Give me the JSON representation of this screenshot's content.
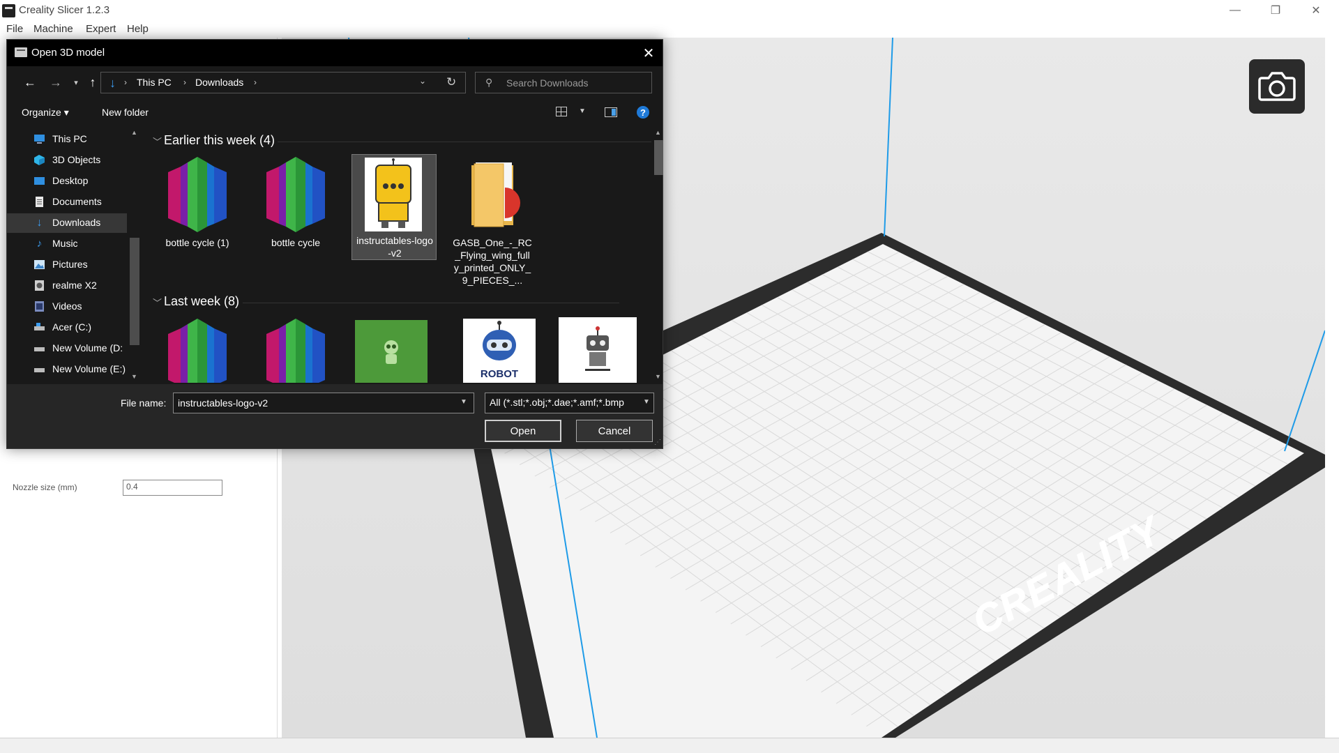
{
  "app": {
    "title": "Creality Slicer 1.2.3",
    "menu": [
      "File",
      "Machine",
      "Expert",
      "Help"
    ],
    "window_controls": {
      "minimize": "—",
      "restore": "❐",
      "close": "✕"
    }
  },
  "left_panel": {
    "nozzle_label": "Nozzle size (mm)",
    "nozzle_value": "0.4"
  },
  "viewport": {
    "bed_logo": "CREALITY",
    "camera_icon": "camera-icon"
  },
  "dialog": {
    "title": "Open 3D model",
    "breadcrumb": [
      "This PC",
      "Downloads"
    ],
    "search_placeholder": "Search Downloads",
    "toolbar": {
      "organize": "Organize ▾",
      "new_folder": "New folder"
    },
    "nav_items": [
      {
        "label": "This PC",
        "icon": "computer-icon",
        "selected": false
      },
      {
        "label": "3D Objects",
        "icon": "cube-icon",
        "selected": false
      },
      {
        "label": "Desktop",
        "icon": "desktop-icon",
        "selected": false
      },
      {
        "label": "Documents",
        "icon": "document-icon",
        "selected": false
      },
      {
        "label": "Downloads",
        "icon": "download-icon",
        "selected": true
      },
      {
        "label": "Music",
        "icon": "music-icon",
        "selected": false
      },
      {
        "label": "Pictures",
        "icon": "picture-icon",
        "selected": false
      },
      {
        "label": "realme X2",
        "icon": "phone-icon",
        "selected": false
      },
      {
        "label": "Videos",
        "icon": "video-icon",
        "selected": false
      },
      {
        "label": "Acer (C:)",
        "icon": "drive-icon",
        "selected": false
      },
      {
        "label": "New Volume (D:",
        "icon": "drive-icon",
        "selected": false
      },
      {
        "label": "New Volume (E:)",
        "icon": "drive-icon",
        "selected": false
      }
    ],
    "groups": [
      {
        "title": "Earlier this week (4)",
        "files": [
          {
            "label": "bottle cycle (1)",
            "thumb": "bottle-thumbnail",
            "selected": false
          },
          {
            "label": "bottle cycle",
            "thumb": "bottle-thumbnail",
            "selected": false
          },
          {
            "label": "instructables-logo-v2",
            "thumb": "robot-thumbnail",
            "selected": true
          },
          {
            "label": "GASB_One_-_RC_Flying_wing_fully_printed_ONLY_9_PIECES_...",
            "thumb": "folder-thumbnail",
            "selected": false
          }
        ]
      },
      {
        "title": "Last week (8)",
        "files": [
          {
            "thumb": "bottle-thumbnail"
          },
          {
            "thumb": "bottle-thumbnail"
          },
          {
            "thumb": "green-robot-thumbnail"
          },
          {
            "thumb": "blue-robot-thumbnail",
            "text": "ROBOT"
          },
          {
            "thumb": "grey-robot-thumbnail"
          }
        ]
      }
    ],
    "file_name_label": "File name:",
    "file_name_value": "instructables-logo-v2",
    "file_type": "All (*.stl;*.obj;*.dae;*.amf;*.bmp",
    "open_label": "Open",
    "cancel_label": "Cancel"
  }
}
